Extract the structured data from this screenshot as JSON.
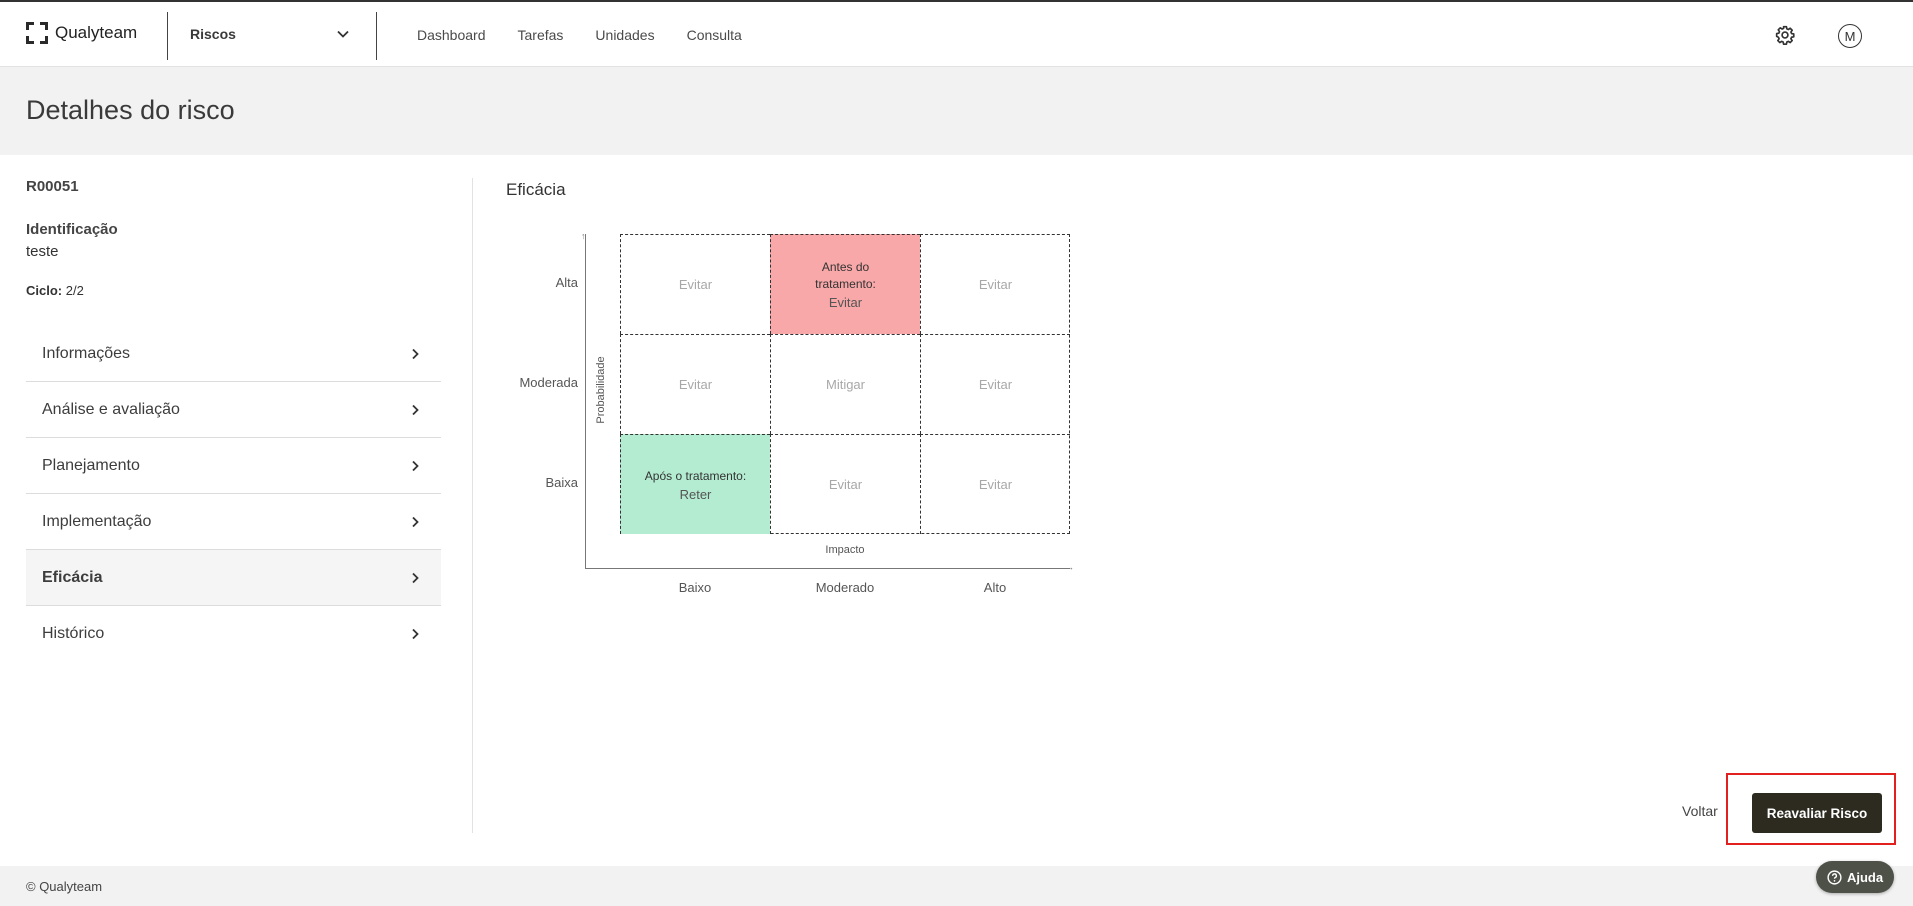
{
  "app": {
    "brand": "Qualyteam",
    "module": "Riscos"
  },
  "nav": {
    "items": [
      "Dashboard",
      "Tarefas",
      "Unidades",
      "Consulta"
    ]
  },
  "user": {
    "avatar_letter": "M"
  },
  "page": {
    "title": "Detalhes do risco"
  },
  "risk": {
    "id": "R00051",
    "identification_label": "Identificação",
    "identification_value": "teste",
    "cycle_label": "Ciclo:",
    "cycle_value": "2/2"
  },
  "sidebar": {
    "items": [
      {
        "label": "Informações"
      },
      {
        "label": "Análise e avaliação"
      },
      {
        "label": "Planejamento"
      },
      {
        "label": "Implementação"
      },
      {
        "label": "Eficácia",
        "active": true
      },
      {
        "label": "Histórico"
      }
    ]
  },
  "efficacy": {
    "title": "Eficácia",
    "y_axis_title": "Probabilidade",
    "x_axis_title": "Impacto",
    "y_labels": [
      "Alta",
      "Moderada",
      "Baixa"
    ],
    "x_labels": [
      "Baixo",
      "Moderado",
      "Alto"
    ],
    "cells": [
      [
        "Evitar",
        "Evitar",
        "Evitar"
      ],
      [
        "Evitar",
        "Mitigar",
        "Evitar"
      ],
      [
        "Reter",
        "Evitar",
        "Evitar"
      ]
    ],
    "before_label": "Antes do tratamento:",
    "after_label": "Após o tratamento:",
    "colors": {
      "before": "#f8a8a8",
      "after": "#b4ecd2"
    }
  },
  "actions": {
    "back": "Voltar",
    "reevaluate": "Reavaliar Risco"
  },
  "footer": {
    "copyright": "© Qualyteam"
  },
  "help": {
    "label": "Ajuda"
  }
}
